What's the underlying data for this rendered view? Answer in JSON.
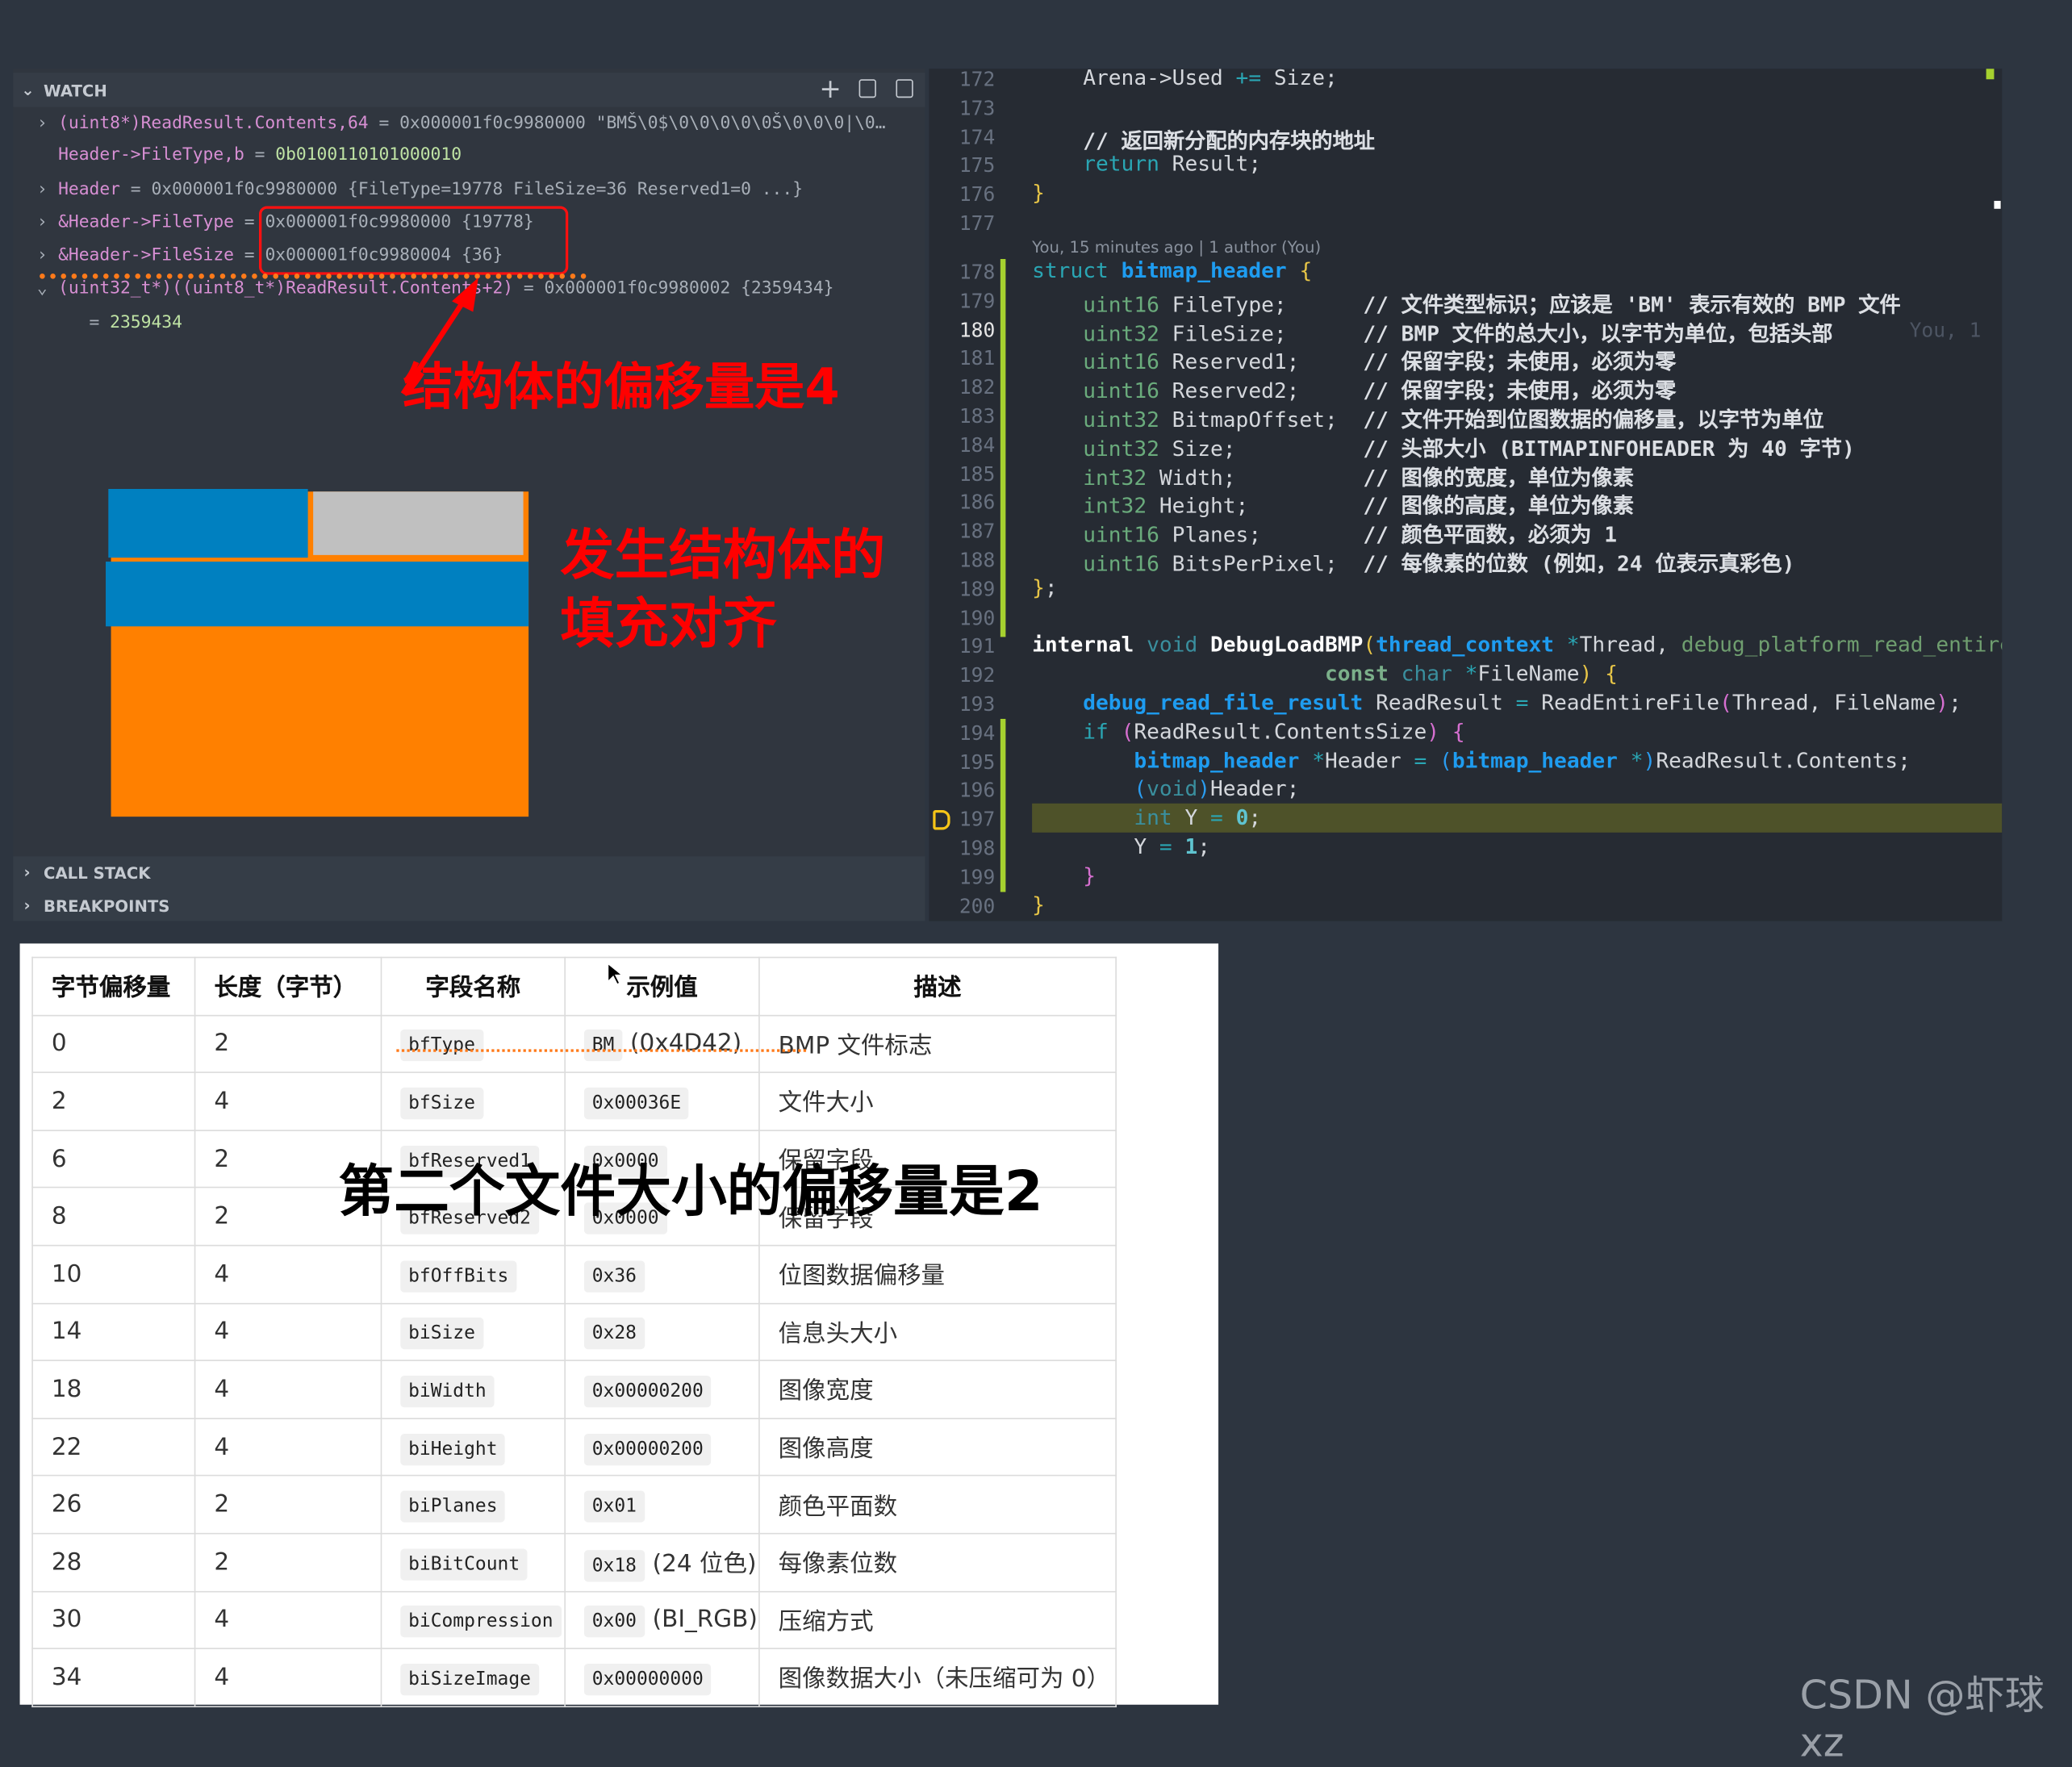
{
  "watch": {
    "title": "WATCH",
    "lines": [
      {
        "chev": "›",
        "segs": [
          [
            "pk",
            "(uint8*)ReadResult.Contents,64"
          ],
          [
            "gy",
            " = 0x000001f0c9980000 \"BMŠ\\0$\\0\\0\\0\\0\\0Š\\0\\0\\0|\\0…"
          ]
        ]
      },
      {
        "chev": "",
        "segs": [
          [
            "pk",
            "Header->FileType,b"
          ],
          [
            "gy",
            " = "
          ],
          [
            "gn",
            "0b0100110101000010"
          ]
        ]
      },
      {
        "chev": "›",
        "segs": [
          [
            "pk",
            "Header"
          ],
          [
            "gy",
            " = 0x000001f0c9980000 {FileType=19778 FileSize=36 Reserved1=0 ...}"
          ]
        ]
      },
      {
        "chev": "›",
        "segs": [
          [
            "pk",
            "&Header->FileType"
          ],
          [
            "gy",
            " = 0x000001f0c9980000 {19778}"
          ]
        ]
      },
      {
        "chev": "›",
        "segs": [
          [
            "pk",
            "&Header->FileSize"
          ],
          [
            "gy",
            " = 0x000001f0c9980004 {36}"
          ]
        ]
      },
      {
        "chev": "⌄",
        "segs": [
          [
            "pk",
            "(uint32_t*)((uint8_t*)ReadResult.Contents+2)"
          ],
          [
            "gy",
            " = 0x000001f0c9980002 {2359434}"
          ]
        ]
      },
      {
        "chev": "",
        "segs": [
          [
            "gy",
            "   = "
          ],
          [
            "gn",
            "2359434"
          ]
        ]
      }
    ]
  },
  "call_stack": "CALL STACK",
  "breakpoints": "BREAKPOINTS",
  "annotations": {
    "offset4": "结构体的偏移量是4",
    "padding_line1": "发生结构体的",
    "padding_line2": "填充对齐",
    "offset2": "第二个文件大小的偏移量是2"
  },
  "colors": {
    "red": "#ff0000",
    "blue": "#0080c0",
    "orange": "#ff8000",
    "gray": "#c0c0c0",
    "highlight": "#4e5229",
    "git": "#a6d12f"
  },
  "codelens": "You, 15 minutes ago | 1 author (You)",
  "blame": "You, 1",
  "code": [
    {
      "n": "172",
      "segs": [
        [
          "id",
          "    Arena->Used "
        ],
        [
          "op",
          "+="
        ],
        [
          "id",
          " Size;"
        ]
      ]
    },
    {
      "n": "173",
      "segs": []
    },
    {
      "n": "174",
      "segs": [
        [
          "cm",
          "    // 返回新分配的内存块的地址"
        ]
      ]
    },
    {
      "n": "175",
      "segs": [
        [
          "kw",
          "    return"
        ],
        [
          "id",
          " Result;"
        ]
      ]
    },
    {
      "n": "176",
      "segs": [
        [
          "br",
          "}"
        ]
      ]
    },
    {
      "n": "177",
      "segs": []
    },
    {
      "n": "178",
      "segs": [
        [
          "kw",
          "struct"
        ],
        [
          "id",
          " "
        ],
        [
          "ty",
          "bitmap_header"
        ],
        [
          "id",
          " "
        ],
        [
          "br",
          "{"
        ]
      ]
    },
    {
      "n": "179",
      "segs": [
        [
          "it",
          "    uint16"
        ],
        [
          "id",
          " FileType;      "
        ],
        [
          "cm",
          "// 文件类型标识；应该是 'BM' 表示有效的 BMP 文件"
        ]
      ]
    },
    {
      "n": "180",
      "segs": [
        [
          "it",
          "    uint32"
        ],
        [
          "id",
          " FileSize;      "
        ],
        [
          "cm",
          "// BMP 文件的总大小，以字节为单位，包括头部"
        ]
      ]
    },
    {
      "n": "181",
      "segs": [
        [
          "it",
          "    uint16"
        ],
        [
          "id",
          " Reserved1;     "
        ],
        [
          "cm",
          "// 保留字段；未使用，必须为零"
        ]
      ]
    },
    {
      "n": "182",
      "segs": [
        [
          "it",
          "    uint16"
        ],
        [
          "id",
          " Reserved2;     "
        ],
        [
          "cm",
          "// 保留字段；未使用，必须为零"
        ]
      ]
    },
    {
      "n": "183",
      "segs": [
        [
          "it",
          "    uint32"
        ],
        [
          "id",
          " BitmapOffset;  "
        ],
        [
          "cm",
          "// 文件开始到位图数据的偏移量，以字节为单位"
        ]
      ]
    },
    {
      "n": "184",
      "segs": [
        [
          "it",
          "    uint32"
        ],
        [
          "id",
          " Size;          "
        ],
        [
          "cm",
          "// 头部大小 (BITMAPINFOHEADER 为 40 字节)"
        ]
      ]
    },
    {
      "n": "185",
      "segs": [
        [
          "it",
          "    int32"
        ],
        [
          "id",
          " Width;          "
        ],
        [
          "cm",
          "// 图像的宽度，单位为像素"
        ]
      ]
    },
    {
      "n": "186",
      "segs": [
        [
          "it",
          "    int32"
        ],
        [
          "id",
          " Height;         "
        ],
        [
          "cm",
          "// 图像的高度，单位为像素"
        ]
      ]
    },
    {
      "n": "187",
      "segs": [
        [
          "it",
          "    uint16"
        ],
        [
          "id",
          " Planes;        "
        ],
        [
          "cm",
          "// 颜色平面数，必须为 1"
        ]
      ]
    },
    {
      "n": "188",
      "segs": [
        [
          "it",
          "    uint16"
        ],
        [
          "id",
          " BitsPerPixel;  "
        ],
        [
          "cm",
          "// 每像素的位数 (例如，24 位表示真彩色)"
        ]
      ]
    },
    {
      "n": "189",
      "segs": [
        [
          "br",
          "}"
        ],
        [
          "id",
          ";"
        ]
      ]
    },
    {
      "n": "190",
      "segs": []
    },
    {
      "n": "191",
      "segs": [
        [
          "bw",
          "internal"
        ],
        [
          "id",
          " "
        ],
        [
          "vd",
          "void"
        ],
        [
          "id",
          " "
        ],
        [
          "bw",
          "DebugLoadBMP"
        ],
        [
          "br",
          "("
        ],
        [
          "ty",
          "thread_context"
        ],
        [
          "id",
          " "
        ],
        [
          "op",
          "*"
        ],
        [
          "id",
          "Thread, "
        ],
        [
          "ds",
          "debug_platform_read_entire"
        ]
      ]
    },
    {
      "n": "192",
      "segs": [
        [
          "id",
          "                       "
        ],
        [
          "cs",
          "const"
        ],
        [
          "id",
          " "
        ],
        [
          "vd",
          "char"
        ],
        [
          "id",
          " "
        ],
        [
          "op",
          "*"
        ],
        [
          "id",
          "FileName"
        ],
        [
          "br",
          ")"
        ],
        [
          "id",
          " "
        ],
        [
          "br",
          "{"
        ]
      ]
    },
    {
      "n": "193",
      "segs": [
        [
          "id",
          "    "
        ],
        [
          "ty",
          "debug_read_file_result"
        ],
        [
          "id",
          " ReadResult "
        ],
        [
          "op",
          "="
        ],
        [
          "id",
          " ReadEntireFile"
        ],
        [
          "pp",
          "("
        ],
        [
          "id",
          "Thread, FileName"
        ],
        [
          "pp",
          ")"
        ],
        [
          "id",
          ";"
        ]
      ]
    },
    {
      "n": "194",
      "segs": [
        [
          "kw",
          "    if"
        ],
        [
          "id",
          " "
        ],
        [
          "pp",
          "("
        ],
        [
          "id",
          "ReadResult.ContentsSize"
        ],
        [
          "pp",
          ")"
        ],
        [
          "id",
          " "
        ],
        [
          "pp",
          "{"
        ]
      ]
    },
    {
      "n": "195",
      "segs": [
        [
          "id",
          "        "
        ],
        [
          "ty",
          "bitmap_header"
        ],
        [
          "id",
          " "
        ],
        [
          "op",
          "*"
        ],
        [
          "id",
          "Header "
        ],
        [
          "op",
          "="
        ],
        [
          "id",
          " "
        ],
        [
          "bp",
          "("
        ],
        [
          "ty",
          "bitmap_header"
        ],
        [
          "id",
          " "
        ],
        [
          "op",
          "*"
        ],
        [
          "bp",
          ")"
        ],
        [
          "id",
          "ReadResult.Contents;"
        ]
      ]
    },
    {
      "n": "196",
      "segs": [
        [
          "id",
          "        "
        ],
        [
          "bp",
          "("
        ],
        [
          "vd",
          "void"
        ],
        [
          "bp",
          ")"
        ],
        [
          "id",
          "Header;"
        ]
      ]
    },
    {
      "n": "197",
      "segs": [
        [
          "vd",
          "        int"
        ],
        [
          "id",
          " Y "
        ],
        [
          "op",
          "="
        ],
        [
          "id",
          " "
        ],
        [
          "nm",
          "0"
        ],
        [
          "id",
          ";"
        ]
      ]
    },
    {
      "n": "198",
      "segs": [
        [
          "id",
          "        Y "
        ],
        [
          "op",
          "="
        ],
        [
          "id",
          " "
        ],
        [
          "nm",
          "1"
        ],
        [
          "id",
          ";"
        ]
      ]
    },
    {
      "n": "199",
      "segs": [
        [
          "pp",
          "    }"
        ]
      ]
    },
    {
      "n": "200",
      "segs": [
        [
          "br",
          "}"
        ]
      ]
    }
  ],
  "table": {
    "headers": [
      "字节偏移量",
      "长度（字节）",
      "字段名称",
      "示例值",
      "描述"
    ],
    "rows": [
      [
        "0",
        "2",
        "bfType",
        "BM",
        "(0x4D42)",
        "BMP 文件标志"
      ],
      [
        "2",
        "4",
        "bfSize",
        "0x00036E",
        "",
        "文件大小"
      ],
      [
        "6",
        "2",
        "bfReserved1",
        "0x0000",
        "",
        "保留字段"
      ],
      [
        "8",
        "2",
        "bfReserved2",
        "0x0000",
        "",
        "保留字段"
      ],
      [
        "10",
        "4",
        "bfOffBits",
        "0x36",
        "",
        "位图数据偏移量"
      ],
      [
        "14",
        "4",
        "biSize",
        "0x28",
        "",
        "信息头大小"
      ],
      [
        "18",
        "4",
        "biWidth",
        "0x00000200",
        "",
        "图像宽度"
      ],
      [
        "22",
        "4",
        "biHeight",
        "0x00000200",
        "",
        "图像高度"
      ],
      [
        "26",
        "2",
        "biPlanes",
        "0x01",
        "",
        "颜色平面数"
      ],
      [
        "28",
        "2",
        "biBitCount",
        "0x18",
        "(24 位色)",
        "每像素位数"
      ],
      [
        "30",
        "4",
        "biCompression",
        "0x00",
        "(BI_RGB)",
        "压缩方式"
      ],
      [
        "34",
        "4",
        "biSizeImage",
        "0x00000000",
        "",
        "图像数据大小（未压缩可为 0）"
      ]
    ]
  },
  "watermark": "CSDN @虾球xz"
}
